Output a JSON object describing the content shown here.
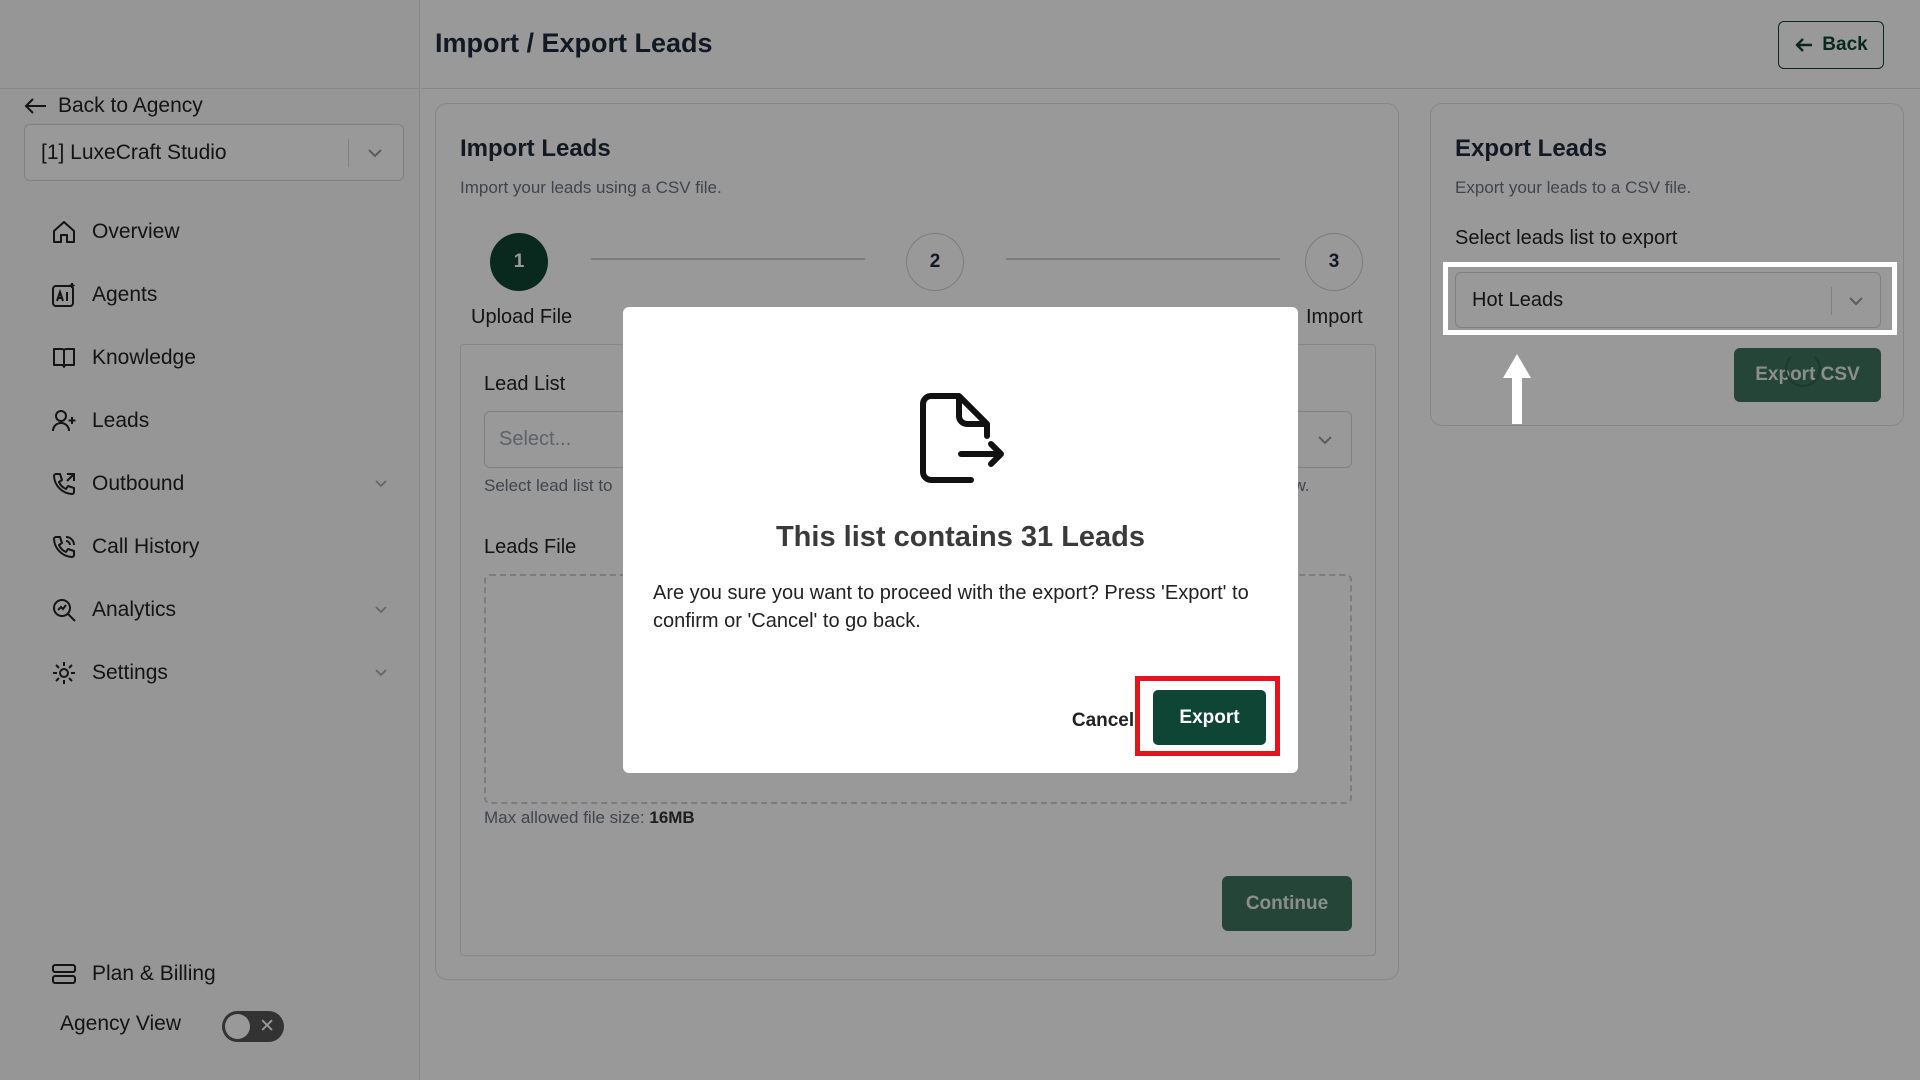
{
  "sidebar": {
    "back_label": "Back to Agency",
    "agency_selected": "[1] LuxeCraft Studio",
    "items": [
      {
        "label": "Overview",
        "icon": "home-icon"
      },
      {
        "label": "Agents",
        "icon": "agents-ai-icon"
      },
      {
        "label": "Knowledge",
        "icon": "book-icon"
      },
      {
        "label": "Leads",
        "icon": "user-plus-icon"
      },
      {
        "label": "Outbound",
        "icon": "phone-outgoing-icon",
        "expandable": true
      },
      {
        "label": "Call History",
        "icon": "phone-history-icon"
      },
      {
        "label": "Analytics",
        "icon": "analytics-icon",
        "expandable": true
      },
      {
        "label": "Settings",
        "icon": "gear-icon",
        "expandable": true
      }
    ],
    "plan_label": "Plan & Billing",
    "agency_view_label": "Agency View",
    "agency_view_on": false
  },
  "header": {
    "title": "Import / Export Leads",
    "back_label": "Back"
  },
  "import": {
    "title": "Import Leads",
    "subtitle": "Import your leads using a CSV file.",
    "steps": [
      {
        "number": "1",
        "label": "Upload File"
      },
      {
        "number": "2",
        "label": ""
      },
      {
        "number": "3",
        "label": "Import"
      }
    ],
    "lead_list_label": "Lead List",
    "lead_list_placeholder": "Select...",
    "lead_list_helper": "Select lead list to",
    "lead_list_helper_end": "ew.",
    "leads_file_label": "Leads File",
    "max_size_text": "Max allowed file size:",
    "max_size_value": "16MB",
    "continue_label": "Continue"
  },
  "export": {
    "title": "Export Leads",
    "subtitle": "Export your leads to a CSV file.",
    "select_label": "Select leads list to export",
    "selected_list": "Hot Leads",
    "export_csv_label": "Export CSV"
  },
  "modal": {
    "icon": "file-export-icon",
    "title": "This list contains 31 Leads",
    "message": "Are you sure you want to proceed with the export? Press 'Export' to confirm or 'Cancel' to go back.",
    "cancel_label": "Cancel",
    "export_label": "Export"
  },
  "colors": {
    "brand": "#0f4535",
    "highlight_red": "#e3141b",
    "highlight_white": "#ffffff"
  }
}
